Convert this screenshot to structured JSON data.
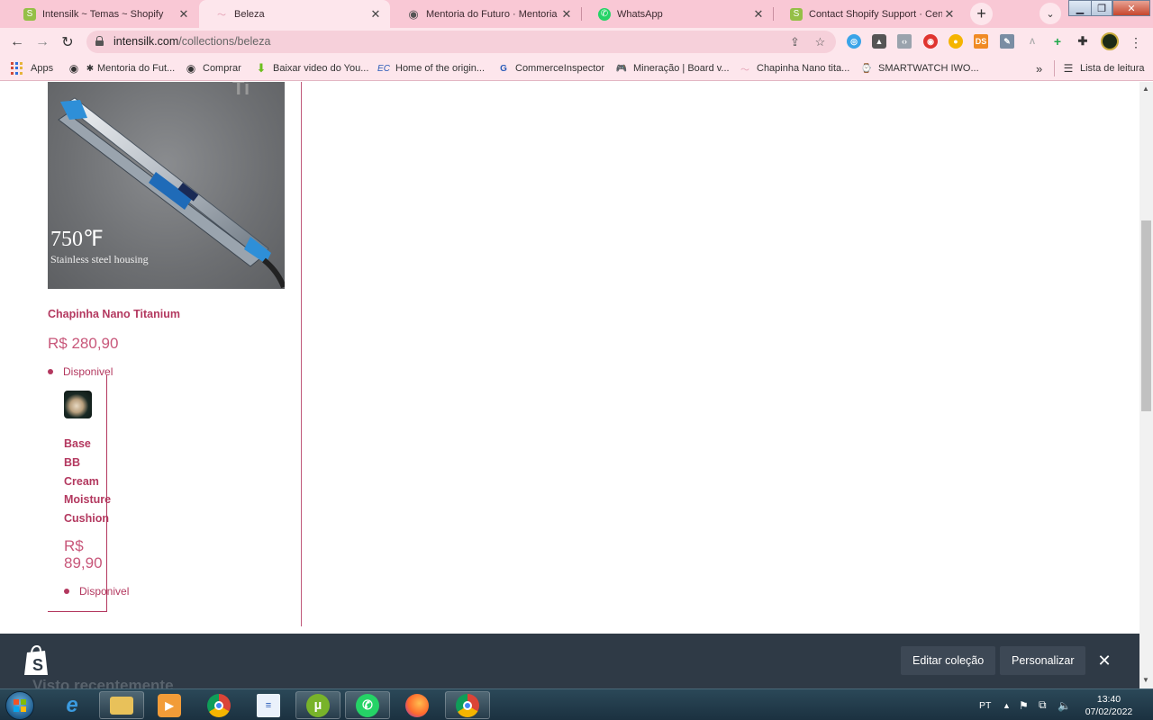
{
  "browser": {
    "tabs": [
      {
        "title": "Intensilk ~ Temas ~ Shopify",
        "favicon": "shopify-icon",
        "active": false
      },
      {
        "title": "Beleza",
        "favicon": "beauty-icon",
        "active": true
      },
      {
        "title": "Mentoria do Futuro · Mentoria",
        "favicon": "globe-icon",
        "active": false
      },
      {
        "title": "WhatsApp",
        "favicon": "whatsapp-icon",
        "active": false
      },
      {
        "title": "Contact Shopify Support · Central",
        "favicon": "shopify-icon",
        "active": false
      }
    ],
    "url_host": "intensilk.com",
    "url_path": "/collections/beleza",
    "bookmarks": [
      {
        "label": "Apps"
      },
      {
        "label": "Mentoria do Fut..."
      },
      {
        "label": "Comprar"
      },
      {
        "label": "Baixar video do You..."
      },
      {
        "label": "Home of the origin..."
      },
      {
        "label": "CommerceInspector"
      },
      {
        "label": "Mineração | Board v..."
      },
      {
        "label": "Chapinha Nano tita..."
      },
      {
        "label": "SMARTWATCH IWO..."
      }
    ],
    "bookmarks_overflow": "»",
    "reading_list": "Lista de leitura"
  },
  "page": {
    "image_overlay": {
      "big": "750℉",
      "small": "Stainless steel housing"
    },
    "products": [
      {
        "title": "Chapinha Nano Titanium",
        "price": "R$ 280,90",
        "availability": "Disponivel"
      },
      {
        "title_lines": [
          "Base",
          "BB",
          "Cream",
          "Moisture",
          "Cushion"
        ],
        "price_lines": [
          "R$",
          "89,90"
        ],
        "availability": "Disponivel"
      }
    ]
  },
  "admin_bar": {
    "edit_collection": "Editar coleção",
    "customize": "Personalizar",
    "faded_text": "Visto recentemente"
  },
  "taskbar": {
    "language": "PT",
    "time": "13:40",
    "date": "07/02/2022"
  },
  "colors": {
    "accent": "#b3385f",
    "price": "#c8577a",
    "tab_strip": "#f9c8d5",
    "admin_bar": "#2f3a46"
  }
}
